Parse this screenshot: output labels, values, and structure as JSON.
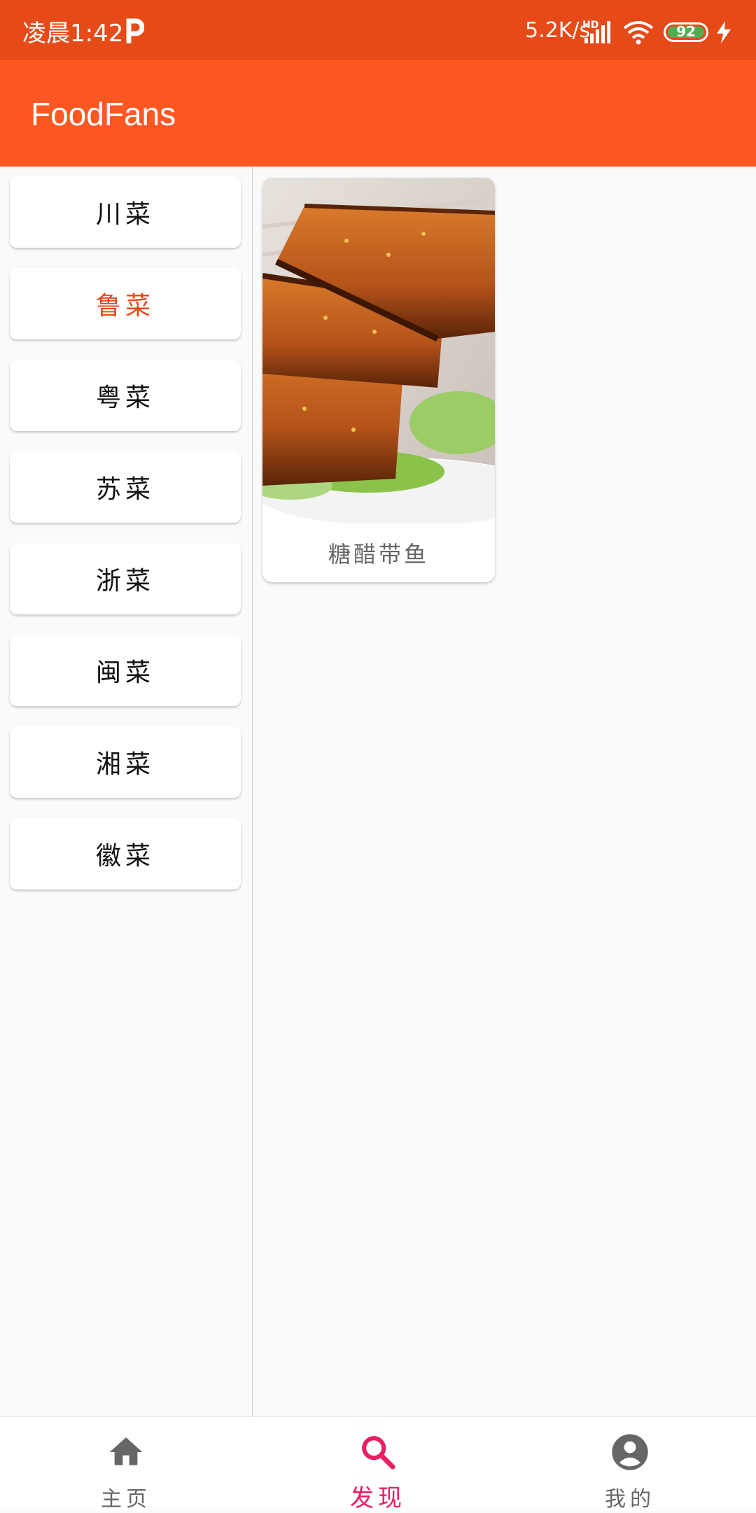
{
  "status_bar": {
    "time": "凌晨1:42",
    "net_speed": "5.2K/s",
    "network_badge": "HD",
    "battery_level": "92",
    "icons": [
      "p-app-icon",
      "signal-icon",
      "wifi-icon",
      "battery-icon",
      "charging-bolt-icon"
    ]
  },
  "app_bar": {
    "title": "FoodFans"
  },
  "categories": {
    "selected": "鲁菜",
    "items": [
      {
        "label": "川菜"
      },
      {
        "label": "鲁菜"
      },
      {
        "label": "粤菜"
      },
      {
        "label": "苏菜"
      },
      {
        "label": "浙菜"
      },
      {
        "label": "闽菜"
      },
      {
        "label": "湘菜"
      },
      {
        "label": "徽菜"
      }
    ]
  },
  "dishes": [
    {
      "name": "糖醋带鱼"
    }
  ],
  "bottom_nav": {
    "active": "发现",
    "items": [
      {
        "label": "主页",
        "icon": "home-icon"
      },
      {
        "label": "发现",
        "icon": "search-icon"
      },
      {
        "label": "我的",
        "icon": "account-icon"
      }
    ]
  },
  "colors": {
    "status_bar": "#e64a19",
    "app_bar": "#ff5722",
    "selected_category": "#e64a19",
    "active_nav": "#e91e63",
    "inactive_nav": "#666666"
  }
}
